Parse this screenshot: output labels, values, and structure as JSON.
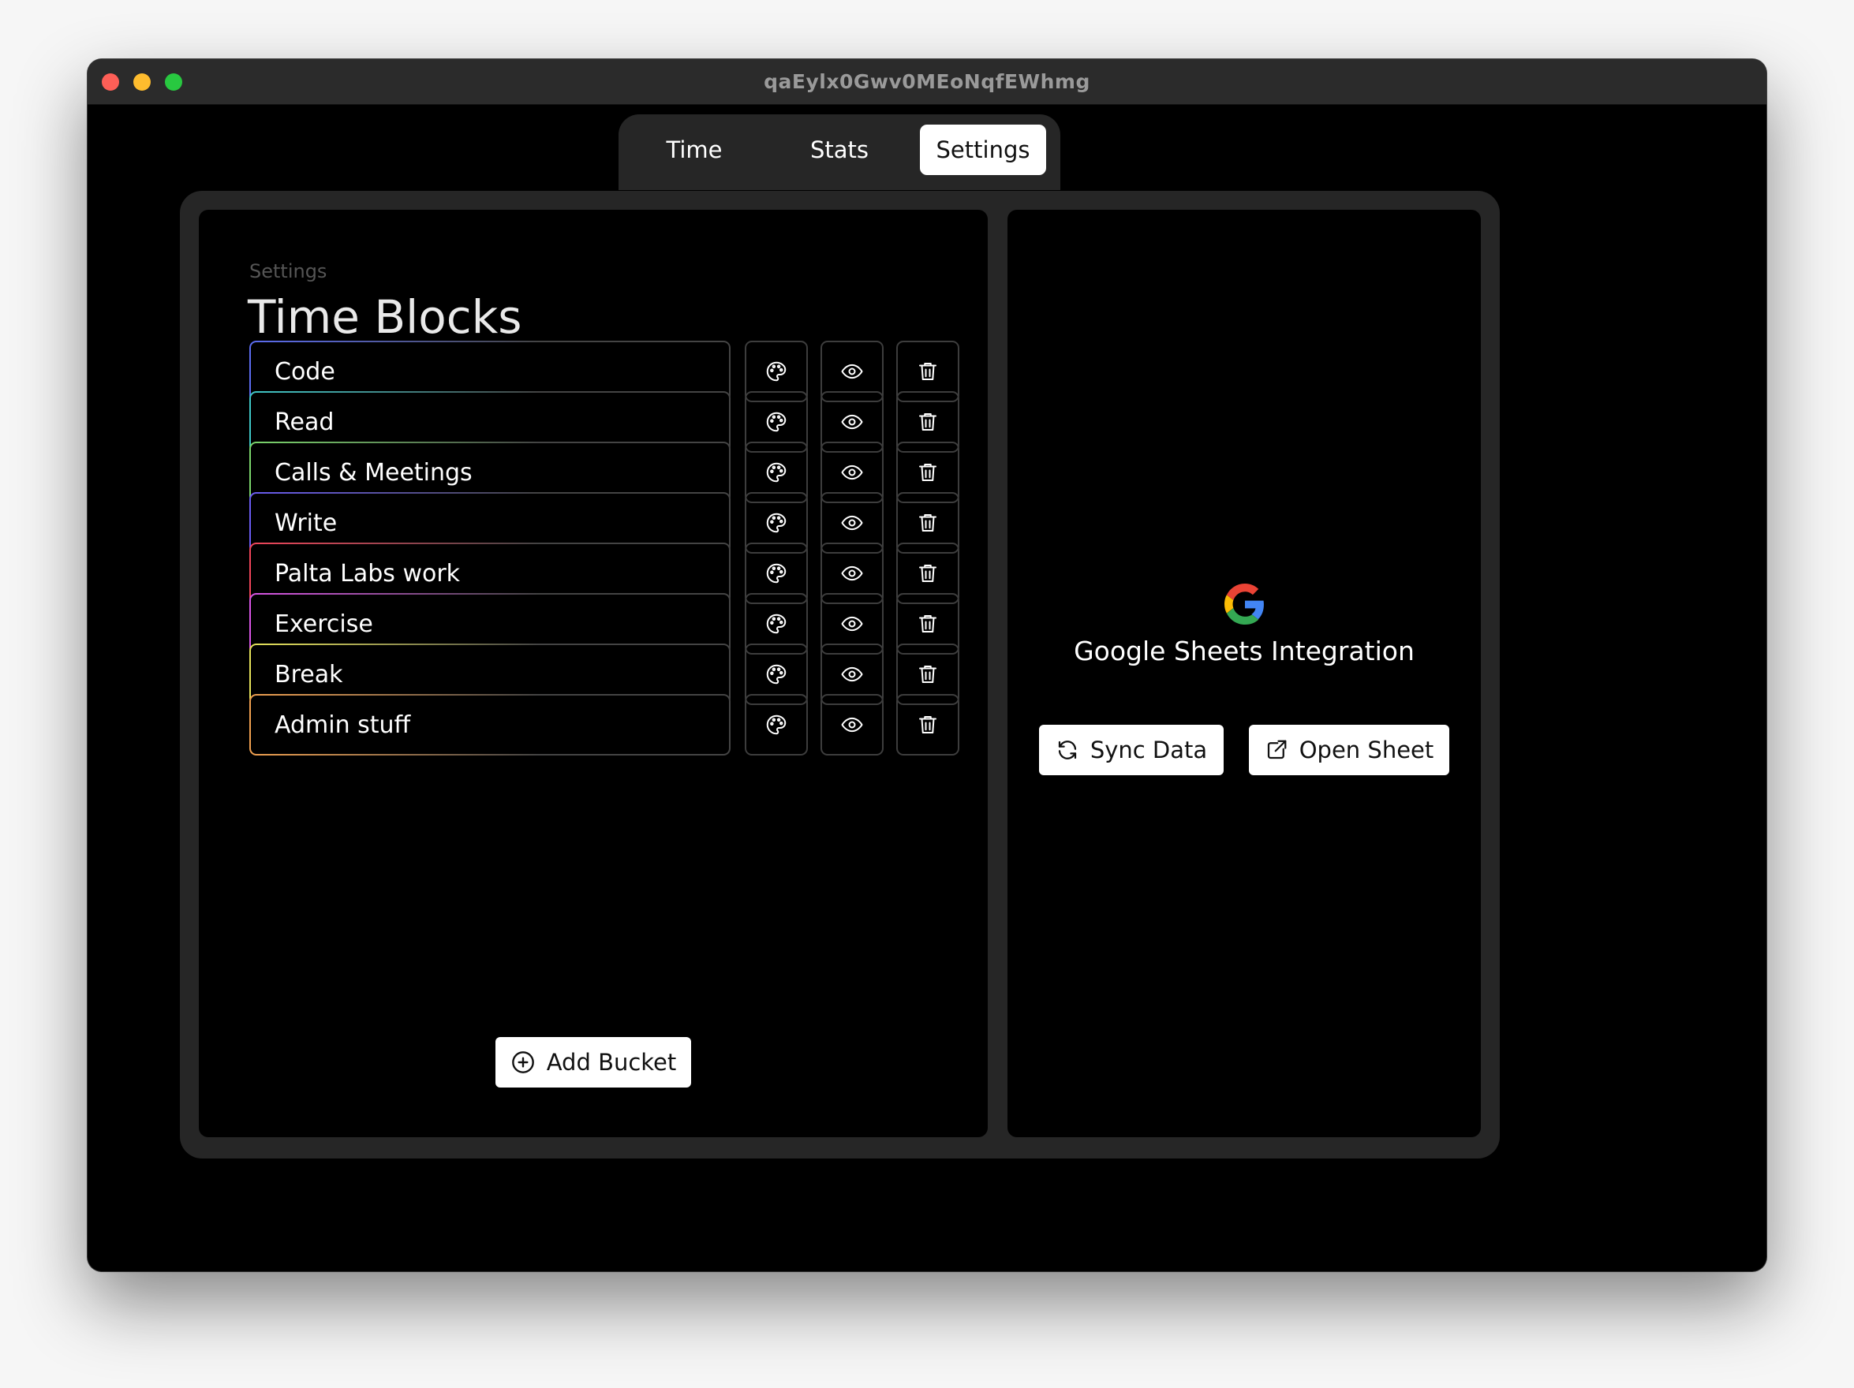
{
  "window": {
    "title": "qaEylx0Gwv0MEoNqfEWhmg"
  },
  "tabs": [
    {
      "label": "Time",
      "active": false
    },
    {
      "label": "Stats",
      "active": false
    },
    {
      "label": "Settings",
      "active": true
    }
  ],
  "settings": {
    "eyebrow": "Settings",
    "heading": "Time Blocks",
    "buckets": [
      {
        "label": "Code",
        "color": "#5b6cf0",
        "icons": [
          "palette-icon",
          "eye-icon",
          "trash-icon"
        ]
      },
      {
        "label": "Read",
        "color": "#3fc7c7",
        "icons": [
          "palette-icon",
          "eye-icon",
          "trash-icon"
        ]
      },
      {
        "label": "Calls & Meetings",
        "color": "#7bd66c",
        "icons": [
          "palette-icon",
          "eye-icon",
          "trash-icon"
        ]
      },
      {
        "label": "Write",
        "color": "#6a5cf2",
        "icons": [
          "palette-icon",
          "eye-icon",
          "trash-icon"
        ]
      },
      {
        "label": "Palta Labs work",
        "color": "#f0455a",
        "icons": [
          "palette-icon",
          "eye-icon",
          "trash-icon"
        ]
      },
      {
        "label": "Exercise",
        "color": "#d955e6",
        "icons": [
          "palette-icon",
          "eye-icon",
          "trash-icon"
        ]
      },
      {
        "label": "Break",
        "color": "#e6e35a",
        "icons": [
          "palette-icon",
          "eye-icon",
          "trash-icon"
        ]
      },
      {
        "label": "Admin stuff",
        "color": "#f0a050",
        "icons": [
          "palette-icon",
          "eye-icon",
          "trash-icon"
        ]
      }
    ],
    "add_button": {
      "label": "Add Bucket",
      "icon": "plus-circle-icon"
    }
  },
  "integration": {
    "logo": "google-g-icon",
    "title": "Google Sheets Integration",
    "sync_button": {
      "label": "Sync Data",
      "icon": "refresh-icon"
    },
    "open_button": {
      "label": "Open Sheet",
      "icon": "external-link-icon"
    }
  }
}
